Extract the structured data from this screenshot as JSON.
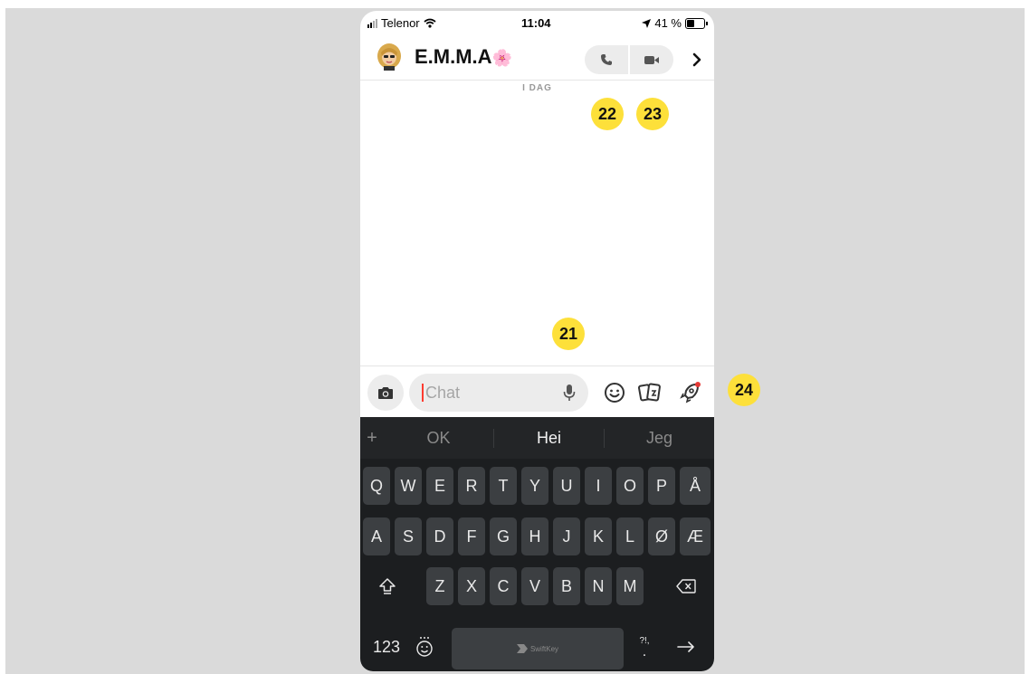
{
  "status_bar": {
    "carrier": "Telenor",
    "time": "11:04",
    "battery": "41 %"
  },
  "header": {
    "contact_name": "E.M.M.A",
    "name_emoji": "🌸"
  },
  "chat": {
    "date_label": "I DAG"
  },
  "input": {
    "placeholder": "Chat"
  },
  "keyboard": {
    "suggestions": [
      "OK",
      "Hei",
      "Jeg"
    ],
    "row1": [
      "Q",
      "W",
      "E",
      "R",
      "T",
      "Y",
      "U",
      "I",
      "O",
      "P",
      "Å"
    ],
    "row2": [
      "A",
      "S",
      "D",
      "F",
      "G",
      "H",
      "J",
      "K",
      "L",
      "Ø",
      "Æ"
    ],
    "row3": [
      "Z",
      "X",
      "C",
      "V",
      "B",
      "N",
      "M"
    ],
    "numbers_label": "123",
    "space_brand": "SwiftKey",
    "punct_label": "?!,",
    "punct_dot": "."
  },
  "markers": {
    "m21": "21",
    "m22": "22",
    "m23": "23",
    "m24": "24"
  },
  "colors": {
    "marker": "#fde03a",
    "keyboard_bg": "#1c1e20",
    "key_bg": "#3c3f42",
    "caret": "#ff3b30",
    "badge": "#e53935"
  },
  "icons": [
    "wifi-icon",
    "location-arrow-icon",
    "battery-icon",
    "avatar",
    "phone-icon",
    "video-icon",
    "chevron-right-icon",
    "camera-icon",
    "microphone-icon",
    "smiley-icon",
    "cards-icon",
    "rocket-icon",
    "shift-icon",
    "backspace-icon",
    "emoji-key-icon",
    "return-arrow-icon"
  ]
}
